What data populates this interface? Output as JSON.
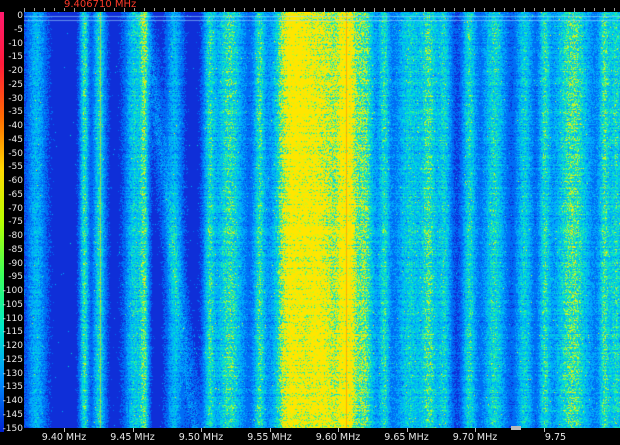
{
  "app": {
    "frequency_readout": "9.406710 MHz"
  },
  "time_axis": {
    "labels": [
      "0",
      "-5",
      "-10",
      "-15",
      "-20",
      "-25",
      "-30",
      "-35",
      "-40",
      "-45",
      "-50",
      "-55",
      "-60",
      "-65",
      "-70",
      "-75",
      "-80",
      "-85",
      "-90",
      "-95",
      "-100",
      "-105",
      "-110",
      "-115",
      "-120",
      "-125",
      "-130",
      "-135",
      "-140",
      "-145",
      "-150"
    ]
  },
  "freq_axis": {
    "labels": [
      "9.40 MHz",
      "9.45 MHz",
      "9.50 MHz",
      "9.55 MHz",
      "9.60 MHz",
      "9.65 MHz",
      "9.70 MHz",
      "9.75"
    ]
  },
  "colors": {
    "background": "#000000",
    "waterfall_base": "#0f2fd8",
    "signal_low": "#00a0ff",
    "signal_mid": "#00e8d0",
    "signal_high": "#c8ff00",
    "signal_peak": "#ffe000",
    "readout": "#ff3a2a",
    "axis_text": "#e6e6e6"
  },
  "color_scale": [
    "#ff1a6e",
    "#ff1a3a",
    "#ff6a00",
    "#ffd800",
    "#b6ff00",
    "#3cff5a",
    "#00e8c8",
    "#0090ff",
    "#0020d0"
  ]
}
